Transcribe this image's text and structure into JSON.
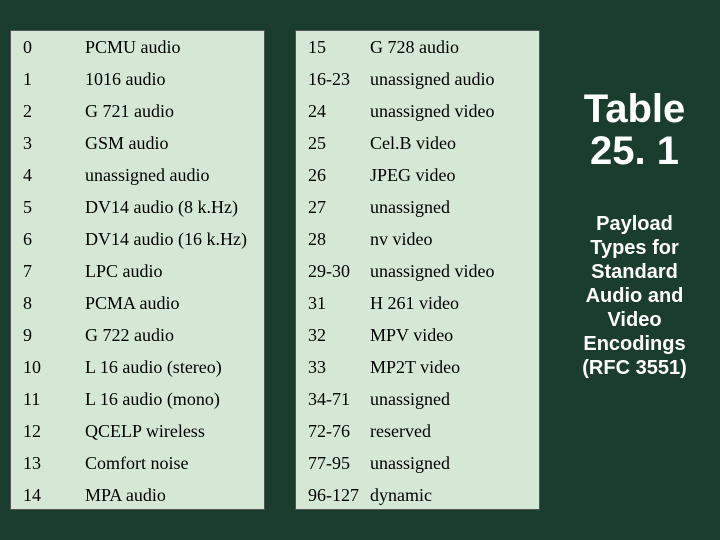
{
  "title": {
    "line1": "Table",
    "line2": "25. 1"
  },
  "subtitle": {
    "l1": "Payload",
    "l2": "Types for",
    "l3": "Standard",
    "l4": "Audio and",
    "l5": "Video",
    "l6": "Encodings",
    "l7": "(RFC 3551)"
  },
  "left": [
    {
      "n": "0",
      "d": "PCMU audio"
    },
    {
      "n": "1",
      "d": "1016 audio"
    },
    {
      "n": "2",
      "d": "G 721 audio"
    },
    {
      "n": "3",
      "d": "GSM audio"
    },
    {
      "n": "4",
      "d": "unassigned audio"
    },
    {
      "n": "5",
      "d": "DV14 audio (8 k.Hz)"
    },
    {
      "n": "6",
      "d": "DV14 audio (16 k.Hz)"
    },
    {
      "n": "7",
      "d": "LPC audio"
    },
    {
      "n": "8",
      "d": "PCMA audio"
    },
    {
      "n": "9",
      "d": "G 722 audio"
    },
    {
      "n": "10",
      "d": "L 16 audio (stereo)"
    },
    {
      "n": "11",
      "d": "L 16 audio (mono)"
    },
    {
      "n": "12",
      "d": "QCELP wireless"
    },
    {
      "n": "13",
      "d": "Comfort noise"
    },
    {
      "n": "14",
      "d": "MPA audio"
    }
  ],
  "right": [
    {
      "n": "15",
      "d": "G 728 audio"
    },
    {
      "n": "16-23",
      "d": "unassigned audio"
    },
    {
      "n": "24",
      "d": "unassigned video"
    },
    {
      "n": "25",
      "d": "Cel.B video"
    },
    {
      "n": "26",
      "d": "JPEG video"
    },
    {
      "n": "27",
      "d": "unassigned"
    },
    {
      "n": "28",
      "d": "nv video"
    },
    {
      "n": "29-30",
      "d": "unassigned video"
    },
    {
      "n": "31",
      "d": "H 261 video"
    },
    {
      "n": "32",
      "d": "MPV video"
    },
    {
      "n": "33",
      "d": "MP2T video"
    },
    {
      "n": "34-71",
      "d": "unassigned"
    },
    {
      "n": "72-76",
      "d": "reserved"
    },
    {
      "n": "77-95",
      "d": "unassigned"
    },
    {
      "n": "96-127",
      "d": "dynamic"
    }
  ]
}
